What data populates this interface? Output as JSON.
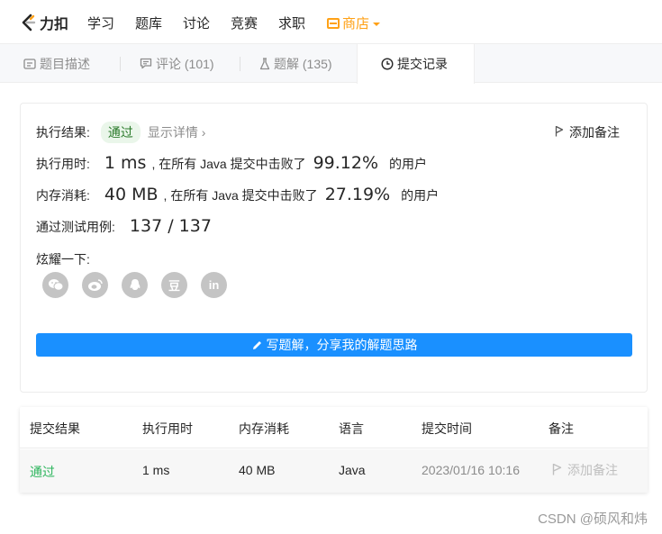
{
  "nav": {
    "logo_text": "力扣",
    "items": [
      "学习",
      "题库",
      "讨论",
      "竞赛",
      "求职"
    ],
    "store_label": "商店"
  },
  "tabs": [
    {
      "label": "题目描述",
      "icon": "description-icon"
    },
    {
      "label": "评论 (101)",
      "icon": "comment-icon"
    },
    {
      "label": "题解 (135)",
      "icon": "flask-icon"
    },
    {
      "label": "提交记录",
      "icon": "clock-icon"
    }
  ],
  "result": {
    "status_label": "执行结果:",
    "status_value": "通过",
    "details_link": "显示详情 ›",
    "add_note": "添加备注",
    "runtime_label": "执行用时:",
    "runtime_value": "1 ms",
    "runtime_mid": ", 在所有 Java 提交中击败了",
    "runtime_pct": "99.12%",
    "runtime_tail": "的用户",
    "memory_label": "内存消耗:",
    "memory_value": "40 MB",
    "memory_mid": ", 在所有 Java 提交中击败了",
    "memory_pct": "27.19%",
    "memory_tail": "的用户",
    "tests_label": "通过测试用例:",
    "tests_value": "137 / 137",
    "share_label": "炫耀一下:",
    "share_icons": [
      "wechat-icon",
      "weibo-icon",
      "qq-icon",
      "douban-icon",
      "linkedin-icon"
    ],
    "share_glyphs": [
      "",
      "",
      "",
      "豆",
      "in"
    ],
    "write_solution": "写题解，分享我的解题思路"
  },
  "table": {
    "headers": [
      "提交结果",
      "执行用时",
      "内存消耗",
      "语言",
      "提交时间",
      "备注"
    ],
    "rows": [
      {
        "status": "通过",
        "runtime": "1 ms",
        "memory": "40 MB",
        "language": "Java",
        "time": "2023/01/16 10:16",
        "note": "添加备注"
      }
    ]
  },
  "watermark": "CSDN @硕风和炜",
  "colors": {
    "accent": "#ffa116",
    "primary": "#1a90ff",
    "success": "#2db55d"
  }
}
